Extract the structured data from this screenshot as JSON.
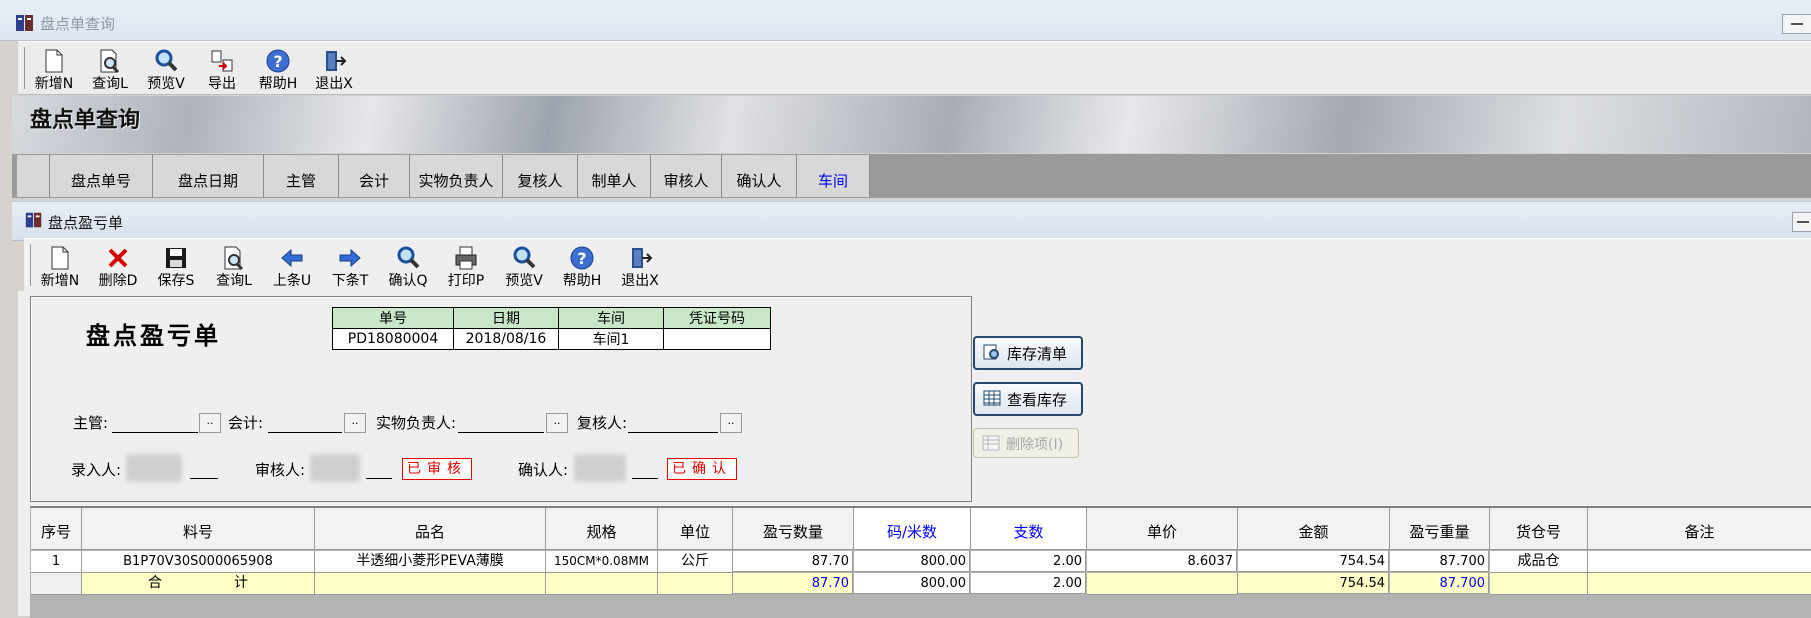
{
  "outer_window": {
    "title": "盘点单查询"
  },
  "outer_toolbar": [
    {
      "label": "新增N",
      "icon": "new-doc-icon"
    },
    {
      "label": "查询L",
      "icon": "doc-search-icon"
    },
    {
      "label": "预览V",
      "icon": "magnifier-icon"
    },
    {
      "label": "导出",
      "icon": "export-icon"
    },
    {
      "label": "帮助H",
      "icon": "help-icon"
    },
    {
      "label": "退出X",
      "icon": "exit-icon"
    }
  ],
  "banner_title": "盘点单查询",
  "query_columns": [
    "盘点单号",
    "盘点日期",
    "主管",
    "会计",
    "实物负责人",
    "复核人",
    "制单人",
    "审核人",
    "确认人",
    "车间"
  ],
  "inner_window": {
    "title": "盘点盈亏单"
  },
  "inner_toolbar": [
    {
      "label": "新增N",
      "icon": "new-doc-icon"
    },
    {
      "label": "删除D",
      "icon": "delete-icon"
    },
    {
      "label": "保存S",
      "icon": "save-icon"
    },
    {
      "label": "查询L",
      "icon": "doc-search-icon"
    },
    {
      "label": "上条U",
      "icon": "arrow-left-icon"
    },
    {
      "label": "下条T",
      "icon": "arrow-right-icon"
    },
    {
      "label": "确认Q",
      "icon": "magnifier-icon"
    },
    {
      "label": "打印P",
      "icon": "printer-icon"
    },
    {
      "label": "预览V",
      "icon": "magnifier-icon"
    },
    {
      "label": "帮助H",
      "icon": "help-icon"
    },
    {
      "label": "退出X",
      "icon": "exit-icon"
    }
  ],
  "form": {
    "title": "盘点盈亏单",
    "info_headers": [
      "单号",
      "日期",
      "车间",
      "凭证号码"
    ],
    "info_values": [
      "PD18080004",
      "2018/08/16",
      "车间1",
      ""
    ],
    "field_labels": {
      "supervisor": "主管:",
      "accountant": "会计:",
      "custodian": "实物负责人:",
      "reviewer": "复核人:",
      "entered_by": "录入人:",
      "auditor": "审核人:",
      "confirmer": "确认人:"
    },
    "dots": "..",
    "stamp_audited": "已审核",
    "stamp_confirmed": "已确认"
  },
  "side_buttons": [
    {
      "label": "库存清单",
      "icon": "inventory-list-icon",
      "enabled": true
    },
    {
      "label": "查看库存",
      "icon": "view-stock-icon",
      "enabled": true
    },
    {
      "label": "删除项(I)",
      "icon": "delete-item-icon",
      "enabled": false
    }
  ],
  "grid": {
    "headers": [
      "序号",
      "料号",
      "品名",
      "规格",
      "单位",
      "盈亏数量",
      "码/米数",
      "支数",
      "单价",
      "金额",
      "盈亏重量",
      "货仓号",
      "备注"
    ],
    "row": [
      "1",
      "B1P70V30S000065908",
      "半透细小菱形PEVA薄膜",
      "150CM*0.08MM",
      "公斤",
      "87.70",
      "800.00",
      "2.00",
      "8.6037",
      "754.54",
      "87.700",
      "成品仓",
      ""
    ],
    "total": {
      "label_a": "合",
      "label_b": "计",
      "qty": "87.70",
      "meters": "800.00",
      "pieces": "2.00",
      "amount": "754.54",
      "weight": "87.700"
    }
  }
}
